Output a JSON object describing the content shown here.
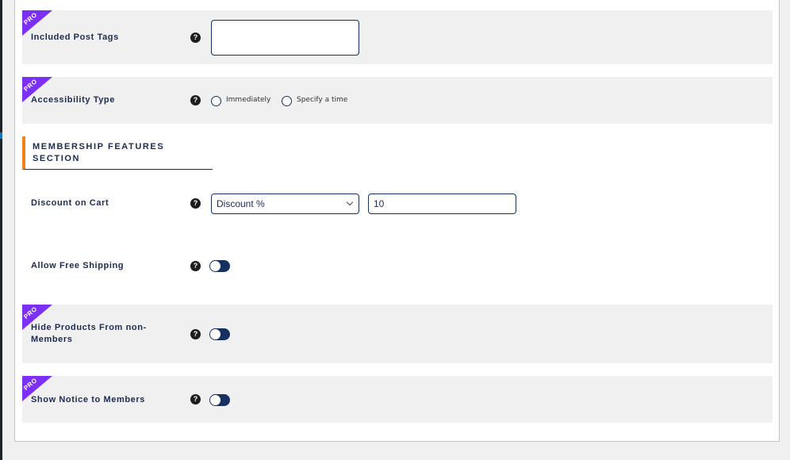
{
  "fields": {
    "included_post_tags": {
      "label": "Included Post Tags",
      "pro_badge": "PRO",
      "help": "?",
      "value": ""
    },
    "accessibility_type": {
      "label": "Accessibility Type",
      "pro_badge": "PRO",
      "help": "?",
      "options": [
        "Immediately",
        "Specify a time"
      ],
      "selected": null
    },
    "section": {
      "title": "MEMBERSHIP FEATURES SECTION"
    },
    "discount_on_cart": {
      "label": "Discount on Cart",
      "help": "?",
      "type_selected": "Discount %",
      "amount": "10"
    },
    "allow_free_shipping": {
      "label": "Allow Free Shipping",
      "help": "?",
      "enabled": false
    },
    "hide_products": {
      "label": "Hide Products From non-Members",
      "pro_badge": "PRO",
      "help": "?",
      "enabled": false
    },
    "show_notice": {
      "label": "Show Notice to Members",
      "pro_badge": "PRO",
      "help": "?",
      "enabled": false
    }
  },
  "colors": {
    "pro": "#7b2ff7",
    "accent": "#f0821e",
    "navy": "#163061"
  }
}
